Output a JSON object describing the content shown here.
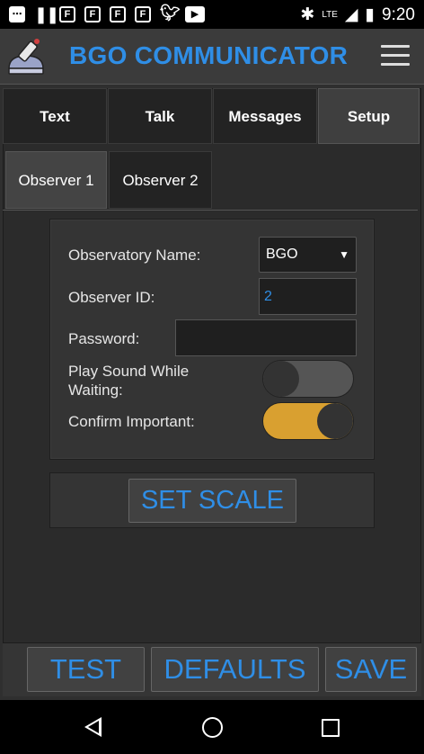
{
  "status_bar": {
    "time": "9:20",
    "network": "LTE",
    "left_icons": [
      "notification-icon",
      "pause-icon",
      "flipboard-icon",
      "flipboard-icon",
      "flipboard-icon",
      "flipboard-icon",
      "twitter-icon",
      "youtube-icon"
    ],
    "right_icons": [
      "bluetooth-icon",
      "signal-icon",
      "battery-icon"
    ]
  },
  "header": {
    "title": "BGO COMMUNICATOR",
    "accent_color": "#2f8ee6"
  },
  "tabs": [
    {
      "label": "Text",
      "active": false
    },
    {
      "label": "Talk",
      "active": false
    },
    {
      "label": "Messages",
      "active": false
    },
    {
      "label": "Setup",
      "active": true
    }
  ],
  "observer_tabs": [
    {
      "label": "Observer 1",
      "active": true
    },
    {
      "label": "Observer 2",
      "active": false
    }
  ],
  "form": {
    "observatory_name_label": "Observatory Name:",
    "observatory_name_value": "BGO",
    "observer_id_label": "Observer ID:",
    "observer_id_value": "2",
    "password_label": "Password:",
    "password_value": "",
    "play_sound_label_line1": "Play Sound While",
    "play_sound_label_line2": "Waiting:",
    "play_sound_on": false,
    "confirm_important_label": "Confirm Important:",
    "confirm_important_on": true,
    "toggle_on_color": "#d9a030"
  },
  "set_scale_label": "SET SCALE",
  "bottom_buttons": {
    "test": "TEST",
    "defaults": "DEFAULTS",
    "save": "SAVE"
  }
}
